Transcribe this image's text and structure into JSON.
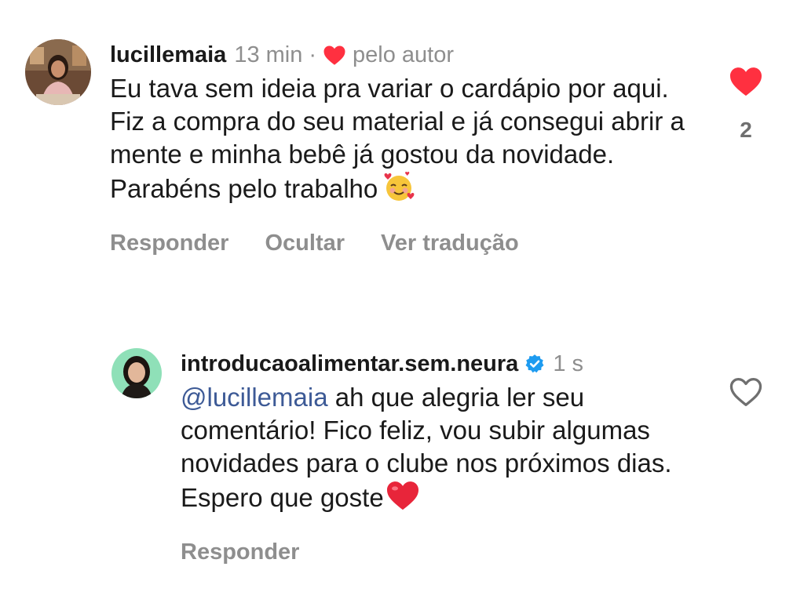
{
  "comments": [
    {
      "username": "lucillemaia",
      "time": "13 min",
      "separator": "·",
      "by_author": "pelo autor",
      "text": "Eu tava sem ideia pra variar o cardápio por aqui. Fiz a compra do seu material e já consegui abrir a mente e minha bebê já gostou da novidade. Parabéns pelo trabalho",
      "emoji": "smiling-face-with-hearts",
      "like_count": "2",
      "liked": true,
      "actions": {
        "reply": "Responder",
        "hide": "Ocultar",
        "translate": "Ver tradução"
      }
    }
  ],
  "reply": {
    "username": "introducaoalimentar.sem.neura",
    "verified": true,
    "time": "1 s",
    "mention": "@lucillemaia",
    "text": " ah que alegria ler seu comentário! Fico feliz, vou subir algumas novidades para o clube nos próximos dias. Espero que goste",
    "emoji": "red-heart",
    "liked": false,
    "actions": {
      "reply": "Responder"
    }
  },
  "colors": {
    "like_red": "#ff3040",
    "muted_text": "#8e8e8e",
    "mention_blue": "#3d5a96",
    "verified_blue": "#1d9bf0"
  }
}
